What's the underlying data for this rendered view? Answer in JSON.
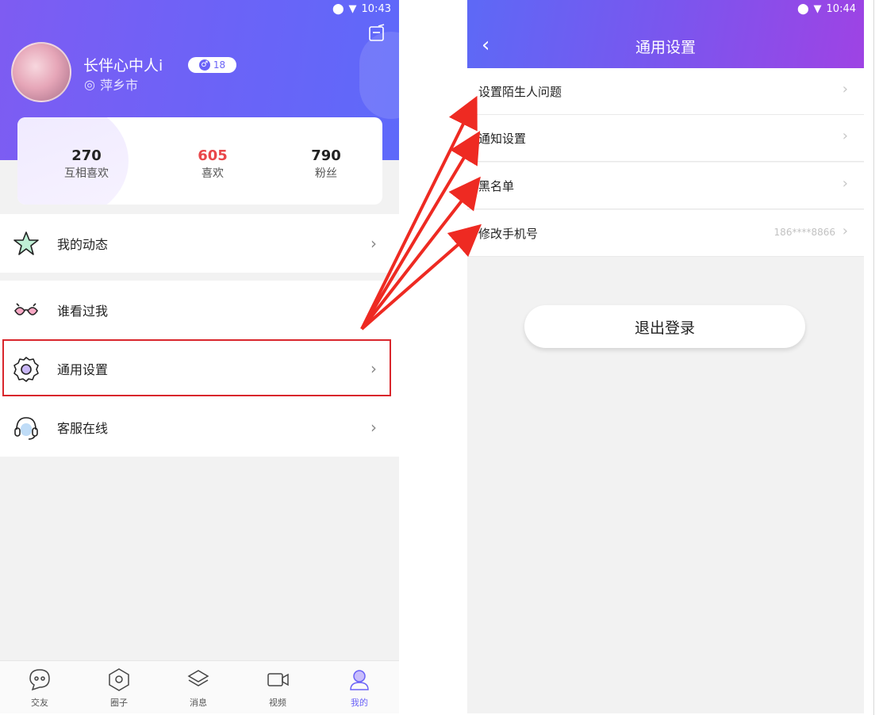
{
  "left": {
    "status_time": "10:43",
    "user_name": "长伴心中人i",
    "age": "18",
    "city": "萍乡市",
    "stats": [
      {
        "value": "270",
        "label": "互相喜欢"
      },
      {
        "value": "605",
        "label": "喜欢"
      },
      {
        "value": "790",
        "label": "粉丝"
      }
    ],
    "menu": [
      {
        "label": "我的动态",
        "icon": "star-icon"
      },
      {
        "label": "谁看过我",
        "icon": "glasses-icon"
      },
      {
        "label": "通用设置",
        "icon": "gear-icon"
      },
      {
        "label": "客服在线",
        "icon": "headset-icon"
      }
    ],
    "tabs": [
      {
        "label": "交友",
        "icon": "chat-icon"
      },
      {
        "label": "圈子",
        "icon": "hexagon-icon"
      },
      {
        "label": "消息",
        "icon": "layers-icon"
      },
      {
        "label": "视频",
        "icon": "video-icon"
      },
      {
        "label": "我的",
        "icon": "profile-icon",
        "active": true
      }
    ]
  },
  "right": {
    "status_time": "10:44",
    "title": "通用设置",
    "items": [
      {
        "label": "设置陌生人问题",
        "value": ""
      },
      {
        "label": "通知设置",
        "value": ""
      },
      {
        "label": "黑名单",
        "value": ""
      },
      {
        "label": "修改手机号",
        "value": "186****8866"
      }
    ],
    "logout_label": "退出登录"
  },
  "colors": {
    "brand_purple": "#6b63f7",
    "highlight_red": "#d9262c",
    "stat_red": "#e9474a"
  }
}
